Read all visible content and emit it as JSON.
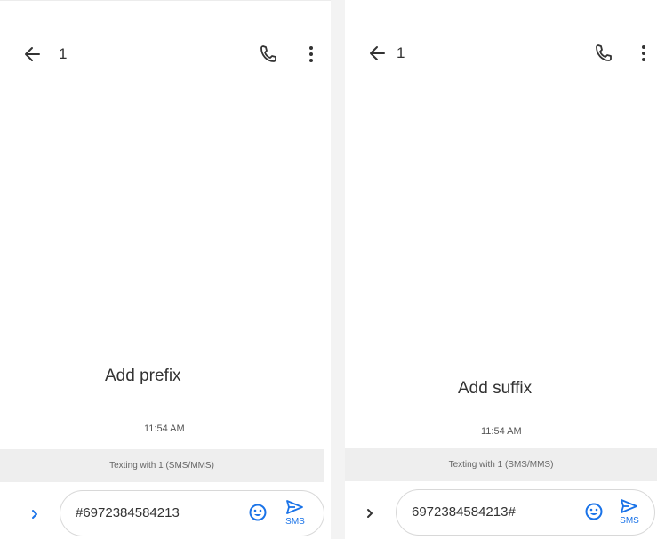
{
  "panels": [
    {
      "title": "1",
      "message": "Add prefix",
      "time": "11:54 AM",
      "status": "Texting with 1 (SMS/MMS)",
      "compose_text": "#6972384584213",
      "send_label": "SMS"
    },
    {
      "title": "1",
      "message": "Add suffix",
      "time": "11:54 AM",
      "status": "Texting with 1 (SMS/MMS)",
      "compose_text": "6972384584213#",
      "send_label": "SMS"
    }
  ],
  "colors": {
    "accent": "#1a73e8",
    "status_bar": "#eeeeee",
    "divider": "#f3f3f3",
    "text": "#333333"
  },
  "icons": {
    "back": "arrow-back-icon",
    "call": "phone-icon",
    "more": "more-vert-icon",
    "expand": "chevron-right-icon",
    "emoji": "emoji-icon",
    "send": "send-icon"
  }
}
